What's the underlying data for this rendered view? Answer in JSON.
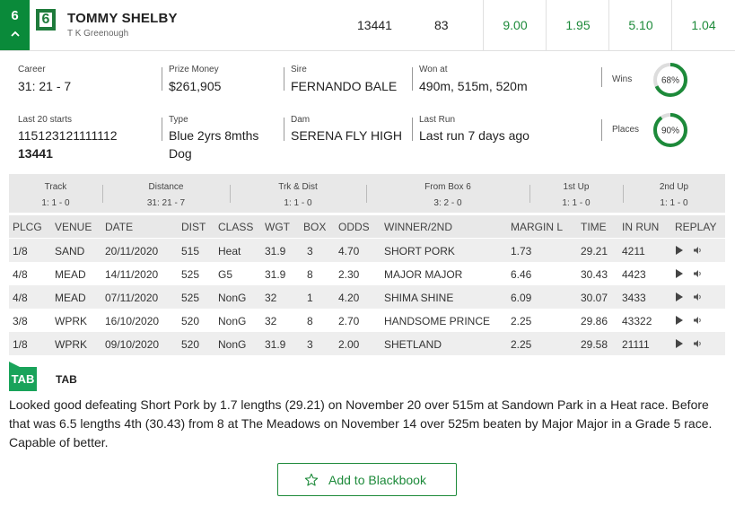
{
  "runner": {
    "number": "6",
    "rug_number": "6",
    "name": "TOMMY SHELBY",
    "trainer": "T K Greenough",
    "form": "13441",
    "rating": "83",
    "odds": [
      "9.00",
      "1.95",
      "5.10",
      "1.04"
    ],
    "colors": {
      "accent": "#0a8a3a",
      "odds": "#1d8a3a"
    }
  },
  "info": {
    "career_label": "Career",
    "career_value": "31: 21 - 7",
    "prize_label": "Prize Money",
    "prize_value": "$261,905",
    "sire_label": "Sire",
    "sire_value": "FERNANDO BALE",
    "won_at_label": "Won at",
    "won_at_value": "490m, 515m, 520m",
    "wins_label": "Wins",
    "wins_pct": 68,
    "wins_text": "68%",
    "last20_label": "Last 20 starts",
    "last20_value": "115123121111112",
    "last20_value2": "13441",
    "type_label": "Type",
    "type_value": "Blue 2yrs 8mths",
    "type_value2": "Dog",
    "dam_label": "Dam",
    "dam_value": "SERENA FLY HIGH",
    "last_run_label": "Last Run",
    "last_run_value": "Last run 7 days ago",
    "places_label": "Places",
    "places_pct": 90,
    "places_text": "90%"
  },
  "summary": [
    {
      "title": "Track",
      "value": "1: 1 - 0"
    },
    {
      "title": "Distance",
      "value": "31: 21 - 7"
    },
    {
      "title": "Trk & Dist",
      "value": "1: 1 - 0"
    },
    {
      "title": "From Box 6",
      "value": "3: 2 - 0"
    },
    {
      "title": "1st Up",
      "value": "1: 1 - 0"
    },
    {
      "title": "2nd Up",
      "value": "1: 1 - 0"
    }
  ],
  "table": {
    "headers": [
      "PLCG",
      "VENUE",
      "DATE",
      "DIST",
      "CLASS",
      "WGT",
      "BOX",
      "ODDS",
      "WINNER/2ND",
      "MARGIN L",
      "TIME",
      "IN RUN",
      "REPLAY"
    ],
    "rows": [
      [
        "1/8",
        "SAND",
        "20/11/2020",
        "515",
        "Heat",
        "31.9",
        "3",
        "4.70",
        "SHORT PORK",
        "1.73",
        "29.21",
        "4211"
      ],
      [
        "4/8",
        "MEAD",
        "14/11/2020",
        "525",
        "G5",
        "31.9",
        "8",
        "2.30",
        "MAJOR MAJOR",
        "6.46",
        "30.43",
        "4423"
      ],
      [
        "4/8",
        "MEAD",
        "07/11/2020",
        "525",
        "NonG",
        "32",
        "1",
        "4.20",
        "SHIMA SHINE",
        "6.09",
        "30.07",
        "3433"
      ],
      [
        "3/8",
        "WPRK",
        "16/10/2020",
        "520",
        "NonG",
        "32",
        "8",
        "2.70",
        "HANDSOME PRINCE",
        "2.25",
        "29.86",
        "43322"
      ],
      [
        "1/8",
        "WPRK",
        "09/10/2020",
        "520",
        "NonG",
        "31.9",
        "3",
        "2.00",
        "SHETLAND",
        "2.25",
        "29.58",
        "21111"
      ]
    ]
  },
  "tab": {
    "logo": "TAB",
    "label": "TAB",
    "comment": "Looked good defeating Short Pork by 1.7 lengths (29.21) on November 20 over 515m at Sandown Park in a Heat race. Before that was 6.5 lengths 4th (30.43) from 8 at The Meadows on November 14 over 525m beaten by Major Major in a Grade 5 race. Capable of better."
  },
  "blackbook_label": "Add to Blackbook"
}
